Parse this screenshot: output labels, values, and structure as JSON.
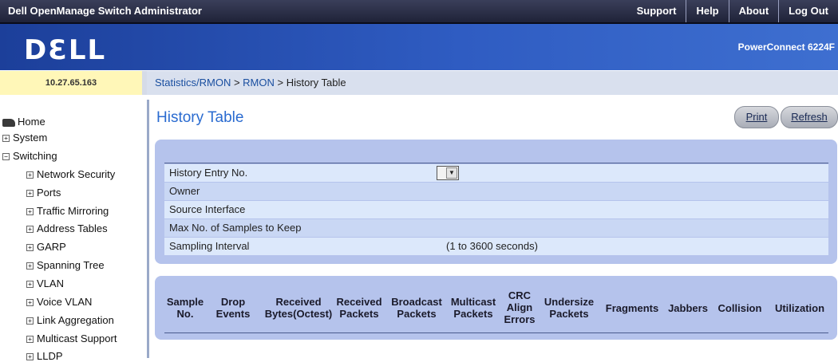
{
  "topbar": {
    "app_title": "Dell OpenManage Switch Administrator",
    "links": [
      "Support",
      "Help",
      "About",
      "Log Out"
    ]
  },
  "header": {
    "logo": "DƐLL",
    "model": "PowerConnect 6224F"
  },
  "ip": "10.27.65.163",
  "breadcrumb": {
    "part1": "Statistics/RMON",
    "sep1": " > ",
    "part2": "RMON",
    "sep2": " > ",
    "current": "History Table"
  },
  "sidebar": {
    "items": [
      {
        "label": "Home",
        "type": "home"
      },
      {
        "label": "System",
        "type": "plus"
      },
      {
        "label": "Switching",
        "type": "minus"
      },
      {
        "label": "Network Security",
        "type": "plus"
      },
      {
        "label": "Ports",
        "type": "plus"
      },
      {
        "label": "Traffic Mirroring",
        "type": "plus"
      },
      {
        "label": "Address Tables",
        "type": "plus"
      },
      {
        "label": "GARP",
        "type": "plus"
      },
      {
        "label": "Spanning Tree",
        "type": "plus"
      },
      {
        "label": "VLAN",
        "type": "plus"
      },
      {
        "label": "Voice VLAN",
        "type": "plus"
      },
      {
        "label": "Link Aggregation",
        "type": "plus"
      },
      {
        "label": "Multicast Support",
        "type": "plus"
      },
      {
        "label": "LLDP",
        "type": "plus"
      }
    ]
  },
  "main": {
    "title": "History Table",
    "print_label": "Print",
    "refresh_label": "Refresh",
    "fields": {
      "entry_label": "History Entry No.",
      "owner_label": "Owner",
      "source_label": "Source Interface",
      "max_label": "Max No. of Samples to Keep",
      "interval_label": "Sampling Interval",
      "interval_hint": "(1 to 3600 seconds)"
    },
    "table_headers": [
      "Sample\nNo.",
      "Drop\nEvents",
      "Received\nBytes(Octest)",
      "Received\nPackets",
      "Broadcast\nPackets",
      "Multicast\nPackets",
      "CRC\nAlign\nErrors",
      "Undersize\nPackets",
      "Fragments",
      "Jabbers",
      "Collision",
      "Utilization"
    ]
  },
  "colors": {
    "topbar": "#1f2238",
    "header": "#2f5cc2",
    "panel": "#b5c3ec",
    "title": "#2a6bd0",
    "ip_bg": "#fff7b8"
  }
}
